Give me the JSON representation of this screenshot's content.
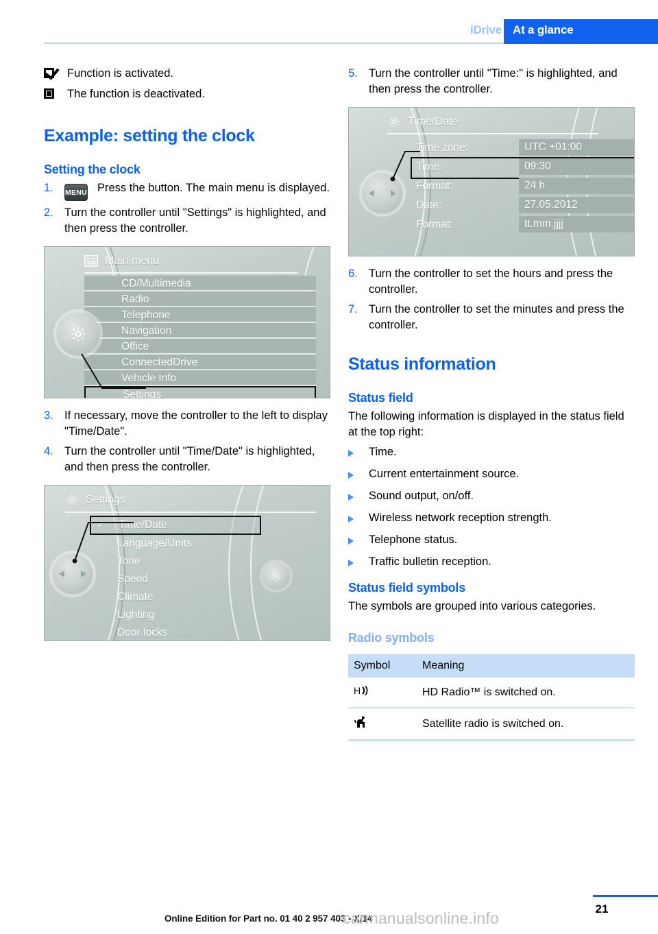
{
  "header": {
    "chapter": "iDrive",
    "section": "At a glance"
  },
  "legend": [
    {
      "icon": "checked-checkbox-icon",
      "text": "Function is activated."
    },
    {
      "icon": "unchecked-checkbox-icon",
      "text": "The function is deactivated."
    }
  ],
  "left_column": {
    "heading": "Example: setting the clock",
    "subheading": "Setting the clock",
    "steps": [
      {
        "num": "1.",
        "key": "MENU",
        "text": "Press the button. The main menu is displayed."
      },
      {
        "num": "2.",
        "text": "Turn the controller until \"Settings\" is highlighted, and then press the controller."
      }
    ],
    "main_menu_screen": {
      "title": "Main menu",
      "title_icon": "list-menu-icon",
      "knob_icon": "gear-icon",
      "items": [
        {
          "label": "CD/Multimedia",
          "selected": false
        },
        {
          "label": "Radio",
          "selected": false
        },
        {
          "label": "Telephone",
          "selected": false
        },
        {
          "label": "Navigation",
          "selected": false
        },
        {
          "label": "Office",
          "selected": false
        },
        {
          "label": "ConnectedDrive",
          "selected": false
        },
        {
          "label": "Vehicle Info",
          "selected": false
        },
        {
          "label": "Settings",
          "selected": true
        }
      ]
    },
    "steps2": [
      {
        "num": "3.",
        "text": "If necessary, move the controller to the left to display \"Time/Date\"."
      },
      {
        "num": "4.",
        "text": "Turn the controller until \"Time/Date\" is highlighted, and then press the controller."
      }
    ],
    "settings_screen": {
      "title": "Settings",
      "title_icon": "gear-icon",
      "knob_icon": "left-right-arrows-icon",
      "side_icon": "gear-icon",
      "items": [
        {
          "label": "Time/Date",
          "selected": true,
          "check": "✓"
        },
        {
          "label": "Language/Units",
          "selected": false
        },
        {
          "label": "Tone",
          "selected": false
        },
        {
          "label": "Speed",
          "selected": false
        },
        {
          "label": "Climate",
          "selected": false
        },
        {
          "label": "Lighting",
          "selected": false
        },
        {
          "label": "Door locks",
          "selected": false
        }
      ]
    }
  },
  "right_column": {
    "steps_top": [
      {
        "num": "5.",
        "text": "Turn the controller until \"Time:\" is highlighted, and then press the controller."
      }
    ],
    "time_date_screen": {
      "title": "Time/Date",
      "title_icon": "gear-icon",
      "knob_icon": "left-right-arrows-icon",
      "rows": [
        {
          "label": "Time zone:",
          "value": "UTC +01:00",
          "selected": false
        },
        {
          "label": "Time:",
          "value": "09:30",
          "selected": true
        },
        {
          "label": "Format:",
          "value": "24 h",
          "selected": false
        },
        {
          "label": "Date:",
          "value": "27.05.2012",
          "selected": false
        },
        {
          "label": "Format:",
          "value": "tt.mm.jjjj",
          "selected": false
        }
      ]
    },
    "steps_bottom": [
      {
        "num": "6.",
        "text": "Turn the controller to set the hours and press the controller."
      },
      {
        "num": "7.",
        "text": "Turn the controller to set the minutes and press the controller."
      }
    ],
    "heading": "Status information",
    "status_field_heading": "Status field",
    "status_field_intro": "The following information is displayed in the status field at the top right:",
    "status_field_items": [
      "Time.",
      "Current entertainment source.",
      "Sound output, on/off.",
      "Wireless network reception strength.",
      "Telephone status.",
      "Traffic bulletin reception."
    ],
    "status_symbols_heading": "Status field symbols",
    "status_symbols_intro": "The symbols are grouped into various categories.",
    "radio_symbols_heading": "Radio symbols",
    "symbols_table": {
      "columns": [
        "Symbol",
        "Meaning"
      ],
      "rows": [
        {
          "symbol_name": "hd-radio-icon",
          "symbol": "H⟫",
          "meaning": "HD Radio™ is switched on."
        },
        {
          "symbol_name": "satellite-radio-icon",
          "symbol": "🐕",
          "meaning": "Satellite radio is switched on."
        }
      ]
    }
  },
  "footer": {
    "page_number": "21",
    "note": "Online Edition for Part no. 01 40 2 957 403 - X/14",
    "watermark": "carmanualsonline.info"
  },
  "colors": {
    "accent_blue": "#1163ef",
    "heading_blue": "#0b61ee",
    "light_blue": "#7fb0f0",
    "table_header": "#c6ddf8",
    "idrive_bg": "#c3cecb"
  }
}
